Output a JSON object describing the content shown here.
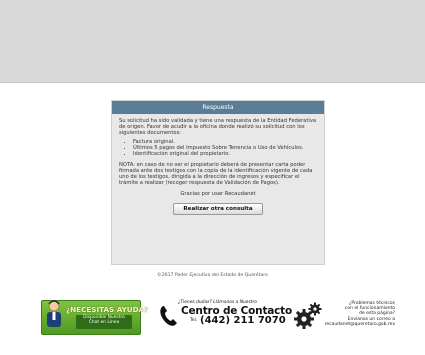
{
  "panel": {
    "title": "Respuesta",
    "intro": "Su solicitud ha sido validada y tiene una respuesta de la Entidad Federativa de origen. Favor de acudir a la oficina donde realizó su solicitud con los siguientes documentos:",
    "documents": [
      "Factura original.",
      "Últimos 5 pagos del Impuesto Sobre Tenencia o Uso de Vehículos.",
      "Identificación original del propietario."
    ],
    "note": "NOTA: en caso de no ser el propietario deberá de presentar carta poder firmada ante dos testigos con la copia de la identificación vigente de cada uno de los testigos, dirigida a la dirección de ingresos y especificar el trámite a realizar (recoger respuesta de Validación de Pagos).",
    "thanks": "Gracias por usar Recaudanet",
    "button_label": "Realizar otra consulta"
  },
  "footer": {
    "copyright": "©2017 Poder Ejecutivo del Estado de Querétaro",
    "help_banner": {
      "title": "¿NECESITAS AYUDA?",
      "subtitle_line1": "Disponible Nuestro",
      "subtitle_line2": "Chat en Línea"
    },
    "contact": {
      "pre": "¿Tienes dudas? Llámanos a Nuestro",
      "title": "Centro de Contacto",
      "tel_label": "Tel.",
      "number": "(442) 211 7070"
    },
    "tech": {
      "line1": "¿Problemas técnicos",
      "line2": "con el funcionamiento",
      "line3": "de esta página?",
      "line4": "Envíanos un correo a",
      "email": "recaudanet@queretaro.gob.mx"
    }
  },
  "colors": {
    "header_band": "#d9d9d9",
    "panel_header": "#5a7d97",
    "help_green": "#5ea82b"
  }
}
